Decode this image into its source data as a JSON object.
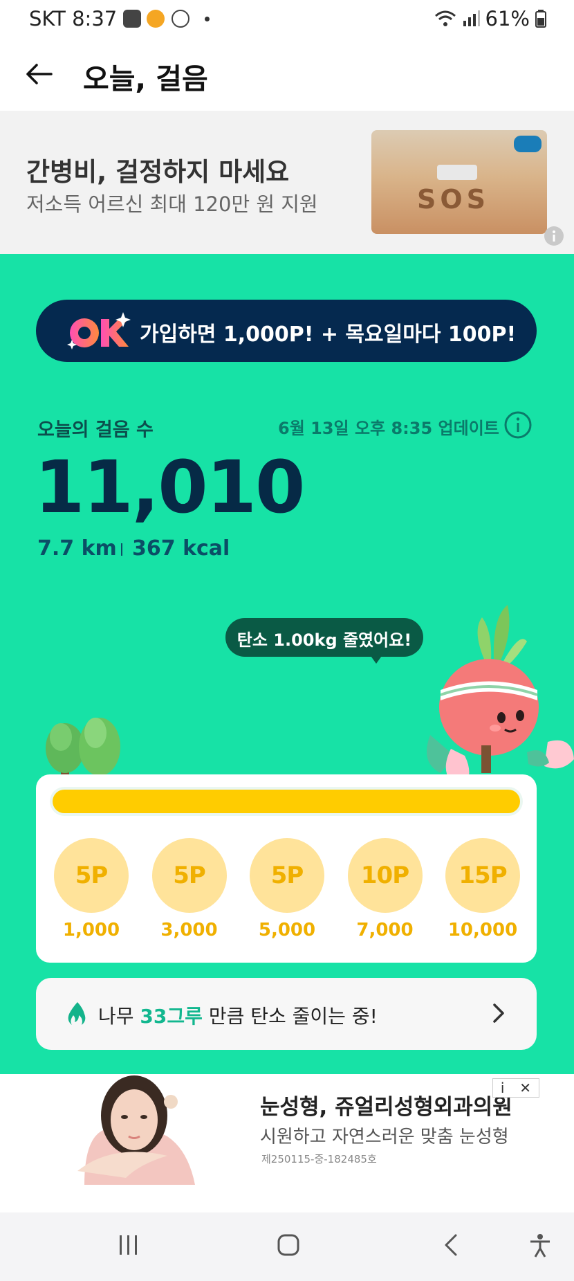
{
  "status_bar": {
    "carrier_time": "SKT 8:37",
    "battery": "61%"
  },
  "header": {
    "title": "오늘, 걸음"
  },
  "top_ad": {
    "headline": "간병비, 걸정하지 마세요",
    "subline": "저소득 어르신 최대 120만 원 지원",
    "image_text": "SOS"
  },
  "promo": {
    "logo_text": "OK",
    "text": "가입하면 1,000P! + 목요일마다 100P!"
  },
  "steps": {
    "label": "오늘의 걸음 수",
    "updated": "6월 13일 오후 8:35 업데이트",
    "count": "11,010",
    "distance": "7.7 km",
    "calories": "367 kcal"
  },
  "carbon_bubble": "탄소 1.00kg 줄였어요!",
  "progress": {
    "fraction": 1.0
  },
  "rewards": [
    {
      "points": "5P",
      "steps": "1,000"
    },
    {
      "points": "5P",
      "steps": "3,000"
    },
    {
      "points": "5P",
      "steps": "5,000"
    },
    {
      "points": "10P",
      "steps": "7,000"
    },
    {
      "points": "15P",
      "steps": "10,000"
    }
  ],
  "carbon_row": {
    "prefix": "나무 ",
    "highlight": "33그루",
    "suffix": " 만큼 탄소 줄이는 중!"
  },
  "bottom_ad": {
    "headline": "눈성형, 쥬얼리성형외과의원",
    "subline": "시원하고 자연스러운 맞춤 눈성형",
    "reg": "제250115-중-182485호",
    "info": "i",
    "close": "✕"
  }
}
